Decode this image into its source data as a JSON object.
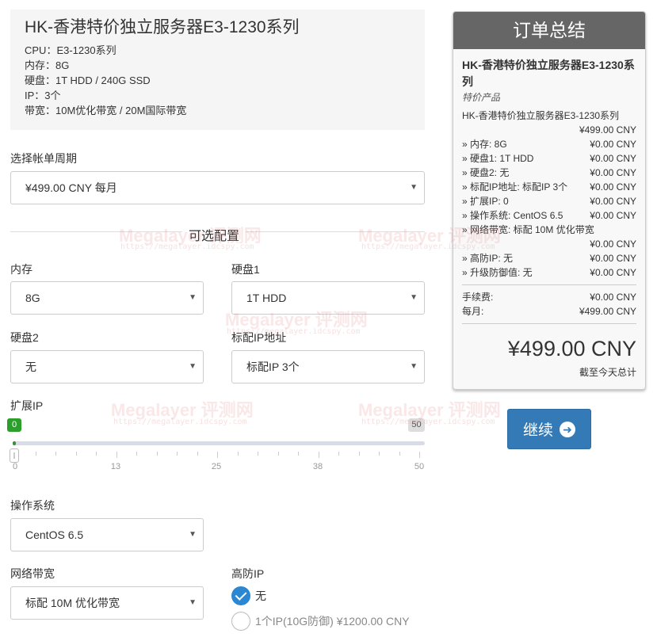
{
  "product": {
    "title": "HK-香港特价独立服务器E3-1230系列",
    "specs": [
      "CPU：E3-1230系列",
      "内存：8G",
      "硬盘：1T HDD / 240G SSD",
      "IP：3个",
      "带宽：10M优化带宽 / 20M国际带宽"
    ]
  },
  "billing": {
    "label": "选择帐单周期",
    "value": "¥499.00 CNY 每月"
  },
  "config": {
    "section_title": "可选配置",
    "memory": {
      "label": "内存",
      "value": "8G"
    },
    "disk1": {
      "label": "硬盘1",
      "value": "1T HDD"
    },
    "disk2": {
      "label": "硬盘2",
      "value": "无"
    },
    "ip_address": {
      "label": "标配IP地址",
      "value": "标配IP 3个"
    },
    "extra_ip": {
      "label": "扩展IP",
      "min": 0,
      "max": 50,
      "current": 0,
      "min_label": "0",
      "max_label": "50",
      "tick_labels": [
        "0",
        "13",
        "25",
        "38",
        "50"
      ]
    },
    "os": {
      "label": "操作系统",
      "value": "CentOS 6.5"
    },
    "bandwidth": {
      "label": "网络带宽",
      "value": "标配 10M 优化带宽"
    },
    "ddos": {
      "label": "高防IP",
      "options": [
        {
          "label": "无",
          "checked": true
        },
        {
          "label": "1个IP(10G防御) ¥1200.00 CNY",
          "checked": false
        }
      ]
    }
  },
  "summary": {
    "header": "订单总结",
    "product_title": "HK-香港特价独立服务器E3-1230系列",
    "product_group": "特价产品",
    "line_name": "HK-香港特价独立服务器E3-1230系列",
    "line_price": "¥499.00 CNY",
    "items": [
      {
        "label": "» 内存: 8G",
        "price": "¥0.00 CNY"
      },
      {
        "label": "» 硬盘1: 1T HDD",
        "price": "¥0.00 CNY"
      },
      {
        "label": "» 硬盘2: 无",
        "price": "¥0.00 CNY"
      },
      {
        "label": "» 标配IP地址: 标配IP 3个",
        "price": "¥0.00 CNY"
      },
      {
        "label": "» 扩展IP: 0",
        "price": "¥0.00 CNY"
      },
      {
        "label": "» 操作系统: CentOS 6.5",
        "price": "¥0.00 CNY"
      },
      {
        "label": "» 网络带宽: 标配 10M 优化带宽",
        "price": "¥0.00 CNY"
      },
      {
        "label": "» 高防IP: 无",
        "price": "¥0.00 CNY"
      },
      {
        "label": "» 升级防御值: 无",
        "price": "¥0.00 CNY"
      }
    ],
    "setup_fee_label": "手续费:",
    "setup_fee": "¥0.00 CNY",
    "monthly_label": "每月:",
    "monthly": "¥499.00 CNY",
    "total": "¥499.00 CNY",
    "total_note": "截至今天总计"
  },
  "continue_label": "继续",
  "watermark": {
    "text": "Megalayer 评测网",
    "url": "https://megalayer.idcspy.com"
  },
  "colors": {
    "accent": "#337ab7",
    "radio_checked": "#2b87d1",
    "slider_min_bubble": "#2aa02a",
    "summary_header": "#666666"
  },
  "icons": {
    "select_arrow": "caret-down-icon",
    "continue": "arrow-circle-right-icon",
    "radio_checked": "check-icon"
  }
}
